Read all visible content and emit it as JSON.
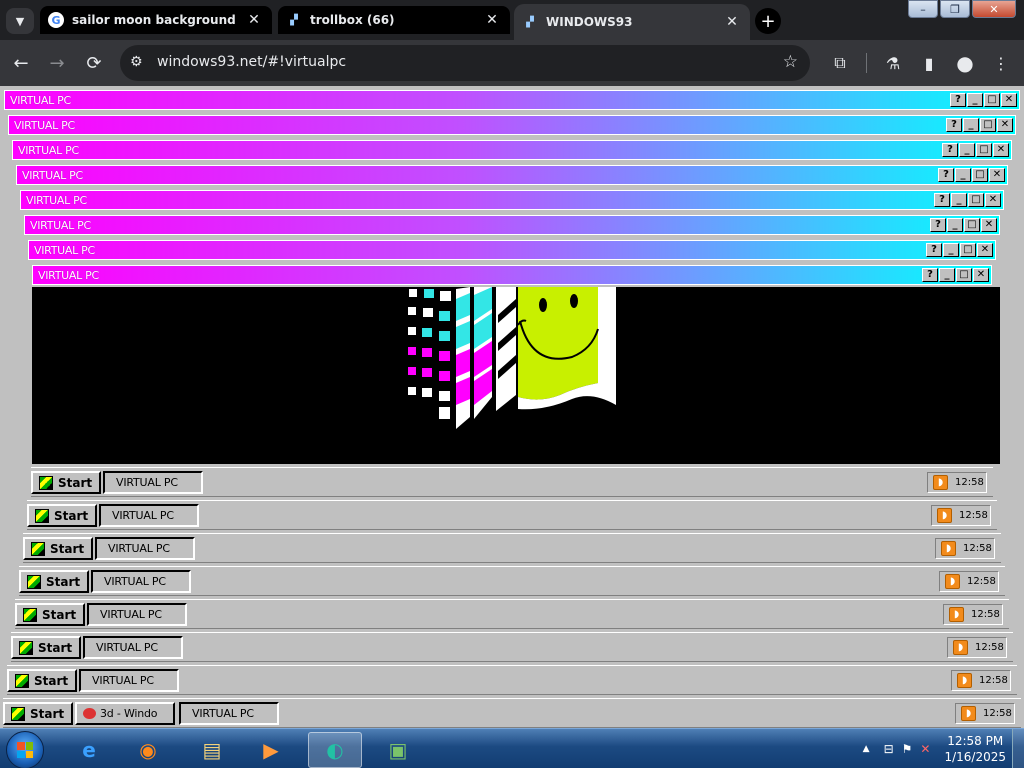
{
  "browser": {
    "tab_search_icon": "chevron-down-icon",
    "tabs": [
      {
        "label": "sailor moon background - Goo",
        "close": "✕",
        "active": false
      },
      {
        "label": "trollbox (66)",
        "close": "✕",
        "active": false
      },
      {
        "label": "WINDOWS93",
        "close": "✕",
        "active": true
      }
    ],
    "new_tab": "+",
    "window_controls": {
      "minimize": "–",
      "restore": "❐",
      "close": "✕"
    },
    "toolbar": {
      "back": "←",
      "forward": "→",
      "reload": "⟳",
      "url": "windows93.net/#!virtualpc",
      "site_info": "⚙",
      "star": "☆"
    },
    "icons": {
      "extensions": "⧉",
      "labs": "⚗",
      "sidepanel": "▮",
      "profile": "●",
      "menu": "⋮"
    }
  },
  "virtualpc": {
    "window_title": "VIRTUAL PC",
    "title_buttons": {
      "help": "?",
      "minimize": "_",
      "maximize": "□",
      "close": "✕"
    },
    "start_label": "Start",
    "task_label": "VIRTUAL PC",
    "outer_task_label": "3d - Windo",
    "clock": "12:58",
    "nesting_levels": 8,
    "gradient_colors": [
      "#ff00ff",
      "#c050ff",
      "#00ffff"
    ],
    "logo_colors": {
      "cyan": "#33e6e6",
      "magenta": "#ff00ff",
      "lime": "#c8f000"
    }
  },
  "win7": {
    "clock_time": "12:58 PM",
    "clock_date": "1/16/2025",
    "pinned": [
      {
        "name": "internet-explorer-icon",
        "glyph": "e"
      },
      {
        "name": "firefox-icon",
        "glyph": "◉"
      },
      {
        "name": "file-explorer-icon",
        "glyph": "▤"
      },
      {
        "name": "media-player-icon",
        "glyph": "▶"
      },
      {
        "name": "chrome-app-icon",
        "glyph": "◐"
      },
      {
        "name": "computer-monitor-icon",
        "glyph": "▣"
      }
    ],
    "tray_icons": [
      "▲",
      "⊟",
      "⚑",
      "✕"
    ]
  }
}
